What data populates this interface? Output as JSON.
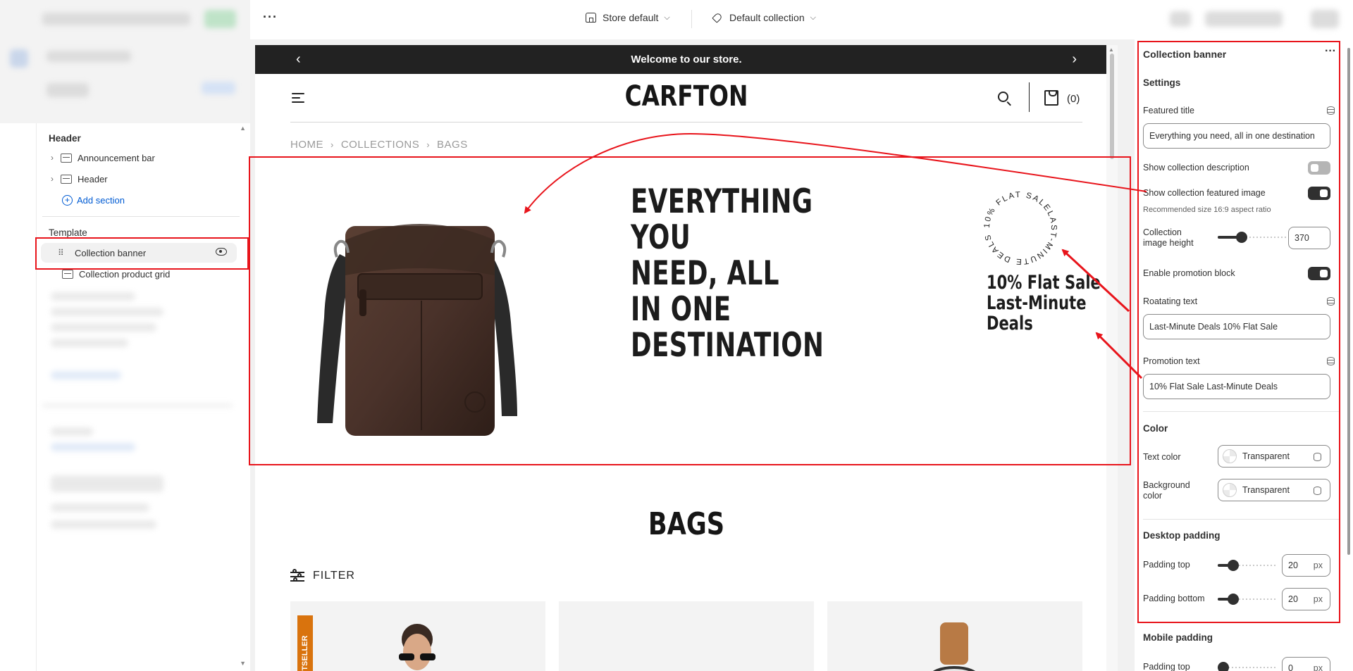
{
  "topbar": {
    "more_label": "···",
    "theme_select": "Store default",
    "template_select": "Default collection"
  },
  "left": {
    "header_group": "Header",
    "header_items": [
      "Announcement bar",
      "Header"
    ],
    "add_section": "Add section",
    "template_group": "Template",
    "template_items": [
      "Collection banner",
      "Collection product grid"
    ]
  },
  "preview": {
    "announcement": "Welcome to our store.",
    "logo": "CARFTON",
    "cart_count": "(0)",
    "breadcrumb": [
      "HOME",
      "COLLECTIONS",
      "BAGS"
    ],
    "banner_title": "EVERYTHING YOU\nNEED, ALL IN ONE\nDESTINATION",
    "rotating_text": "10% FLAT SALELAST-MINUTE DEALS ",
    "promotion_text": "10% Flat Sale Last-Minute Deals",
    "collection_heading": "BAGS",
    "filter_label": "FILTER",
    "product_badge": "STSELLER"
  },
  "settings": {
    "panel_title": "Collection banner",
    "section_settings": "Settings",
    "featured_title_label": "Featured title",
    "featured_title_value": "Everything you need, all in one destination",
    "show_description_label": "Show collection description",
    "show_description_on": false,
    "show_image_label": "Show collection featured image",
    "show_image_on": true,
    "recommended_help": "Recommended size 16:9 aspect ratio",
    "image_height_label": "Collection image height",
    "image_height_value": "370",
    "enable_promo_label": "Enable promotion block",
    "enable_promo_on": true,
    "rotating_label": "Roatating text",
    "rotating_value": "Last-Minute Deals 10% Flat Sale",
    "promotion_label": "Promotion text",
    "promotion_value": "10% Flat Sale Last-Minute Deals",
    "color_heading": "Color",
    "text_color_label": "Text color",
    "text_color_value": "Transparent",
    "bg_color_label": "Background color",
    "bg_color_value": "Transparent",
    "desktop_padding_heading": "Desktop padding",
    "padding_top_label": "Padding top",
    "padding_top_value": "20",
    "padding_bottom_label": "Padding bottom",
    "padding_bottom_value": "20",
    "mobile_padding_heading": "Mobile padding",
    "mobile_padding_top_label": "Padding top",
    "mobile_padding_top_value": "0",
    "unit": "px"
  },
  "colors": {
    "annotation_red": "#e8141b",
    "announcement_bg": "#222222",
    "link_blue": "#005bd3",
    "badge_orange": "#d9730d"
  },
  "icons": [
    "store-icon",
    "tag-icon",
    "chevron-down-icon",
    "section-icon",
    "plus-circle-icon",
    "drag-handle-icon",
    "eye-icon",
    "menu-icon",
    "search-icon",
    "cart-icon",
    "filter-icon",
    "database-icon"
  ]
}
